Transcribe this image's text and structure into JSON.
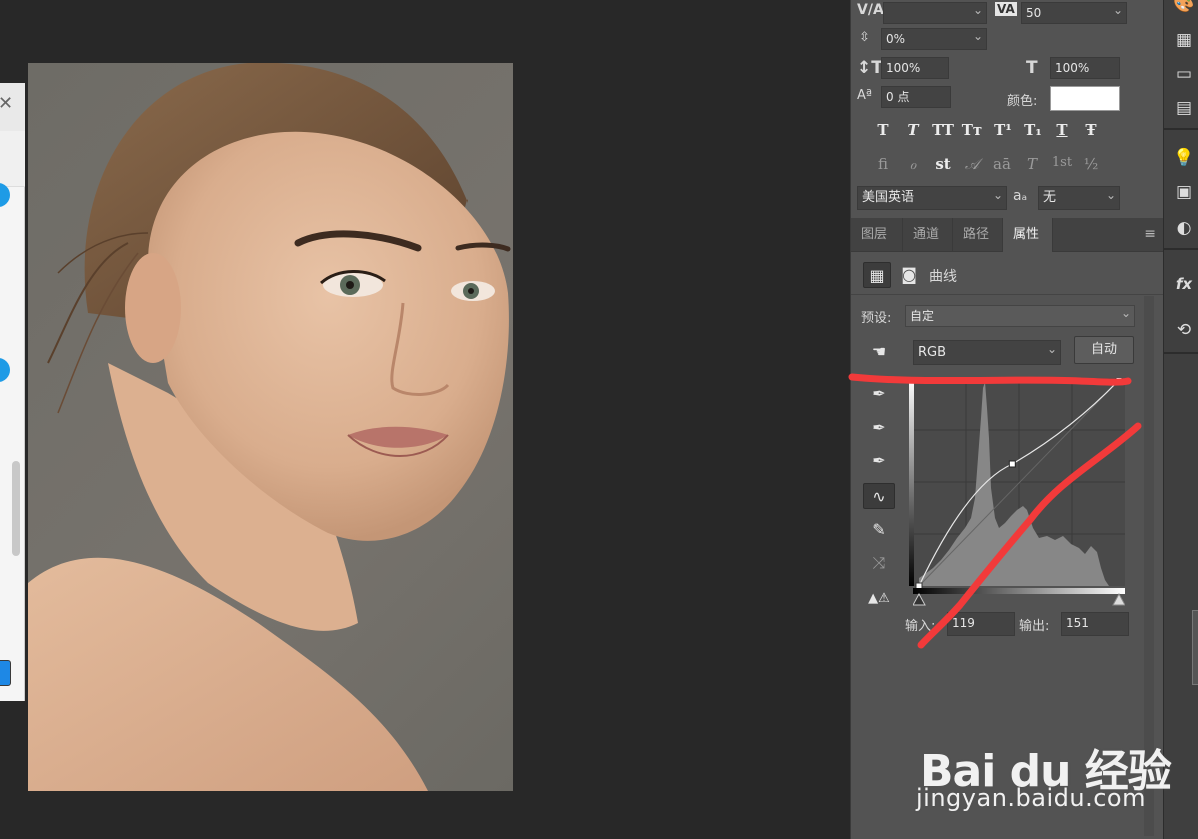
{
  "character": {
    "leading_value": "",
    "tracking_value": "50",
    "baseline_scale": "0%",
    "vertical_scale": "100%",
    "horizontal_scale": "100%",
    "baseline_shift": "0 点",
    "color_label": "颜色:",
    "language": "美国英语",
    "aa_label": "aₐ",
    "antialias": "无",
    "style_buttons": [
      "T",
      "T",
      "TT",
      "Tт",
      "T¹",
      "T₁",
      "T",
      "Ŧ"
    ],
    "opentype_buttons": [
      "ﬁ",
      "ℴ",
      "st",
      "𝒜",
      "aā",
      "T",
      "1st",
      "½"
    ]
  },
  "tabs": [
    {
      "label": "图层"
    },
    {
      "label": "通道"
    },
    {
      "label": "路径"
    },
    {
      "label": "属性"
    }
  ],
  "properties": {
    "title": "曲线",
    "preset_label": "预设:",
    "preset_value": "自定",
    "channel_value": "RGB",
    "auto_label": "自动",
    "input_label": "输入:",
    "input_value": "119",
    "output_label": "输出:",
    "output_value": "151",
    "curve_point": {
      "input": 119,
      "output": 151
    }
  },
  "watermark": {
    "logo_text": "Bai du 经验",
    "url": "jingyan.baidu.com"
  },
  "colors": {
    "panel_bg": "#535353",
    "annotation_red": "#f23a3a",
    "canvas_bg": "#282828"
  }
}
